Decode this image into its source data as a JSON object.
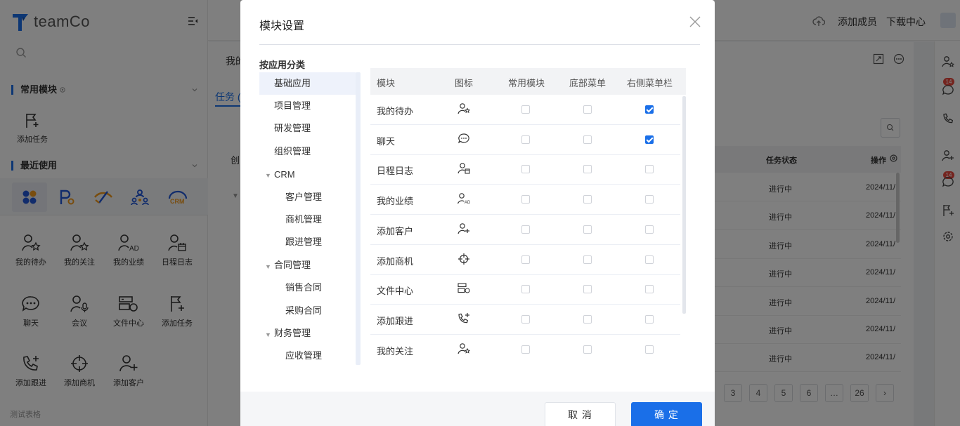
{
  "app": {
    "logo_text": "teamCo"
  },
  "sidebar": {
    "common_title": "常用模块",
    "common_tiles": [
      {
        "label": "添加任务",
        "icon": "flag-plus-icon"
      }
    ],
    "recent_title": "最近使用",
    "recent_icons": [
      "apps-icon",
      "project-p-icon",
      "dev-icon",
      "org-icon",
      "crm-icon"
    ],
    "recent_icon_crm_text": "CRM",
    "module_tiles": [
      {
        "label": "我的待办",
        "icon": "user-star-icon"
      },
      {
        "label": "我的关注",
        "icon": "user-star-outline-icon"
      },
      {
        "label": "我的业绩",
        "icon": "user-ad-icon"
      },
      {
        "label": "日程日志",
        "icon": "user-calendar-icon"
      },
      {
        "label": "聊天",
        "icon": "chat-icon"
      },
      {
        "label": "会议",
        "icon": "user-mic-icon"
      },
      {
        "label": "文件中心",
        "icon": "file-center-icon"
      },
      {
        "label": "添加任务",
        "icon": "flag-plus-icon"
      },
      {
        "label": "添加跟进",
        "icon": "phone-plus-icon"
      },
      {
        "label": "添加商机",
        "icon": "crosshair-icon"
      },
      {
        "label": "添加客户",
        "icon": "user-plus-icon"
      }
    ],
    "footer": "测试表格"
  },
  "topbar": {
    "add_member": "添加成员",
    "download_center": "下载中心"
  },
  "background": {
    "title": "我的",
    "tab": "任务 (",
    "create": "创",
    "table_headers": {
      "status": "任务状态",
      "action": "操作"
    },
    "rows": [
      {
        "status": "进行中",
        "date": "2024/11/"
      },
      {
        "status": "进行中",
        "date": "2024/11/"
      },
      {
        "status": "进行中",
        "date": "2024/11/"
      },
      {
        "status": "进行中",
        "date": "2024/11/"
      },
      {
        "status": "进行中",
        "date": "2024/11/"
      },
      {
        "status": "进行中",
        "date": "2024/11/"
      },
      {
        "status": "进行中",
        "date": "2024/11/"
      }
    ],
    "pagination": [
      "3",
      "4",
      "5",
      "6",
      "…",
      "26",
      "›"
    ],
    "badges": [
      "14",
      "14"
    ]
  },
  "modal": {
    "title": "模块设置",
    "category_label": "按应用分类",
    "tree": [
      {
        "label": "基础应用",
        "level": 0,
        "active": true
      },
      {
        "label": "项目管理",
        "level": 0
      },
      {
        "label": "研发管理",
        "level": 0
      },
      {
        "label": "组织管理",
        "level": 0
      },
      {
        "label": "CRM",
        "level": 0,
        "caret": true
      },
      {
        "label": "客户管理",
        "level": 1
      },
      {
        "label": "商机管理",
        "level": 1
      },
      {
        "label": "跟进管理",
        "level": 1
      },
      {
        "label": "合同管理",
        "level": 0,
        "caret": true
      },
      {
        "label": "销售合同",
        "level": 1
      },
      {
        "label": "采购合同",
        "level": 1
      },
      {
        "label": "财务管理",
        "level": 0,
        "caret": true
      },
      {
        "label": "应收管理",
        "level": 1
      }
    ],
    "columns": [
      "模块",
      "图标",
      "常用模块",
      "底部菜单",
      "右侧菜单栏"
    ],
    "rows": [
      {
        "name": "我的待办",
        "icon": "user-star-icon",
        "common": false,
        "bottom": false,
        "right": true
      },
      {
        "name": "聊天",
        "icon": "chat-icon",
        "common": false,
        "bottom": false,
        "right": true
      },
      {
        "name": "日程日志",
        "icon": "user-calendar-icon",
        "common": false,
        "bottom": false,
        "right": false
      },
      {
        "name": "我的业绩",
        "icon": "user-ad-icon",
        "common": false,
        "bottom": false,
        "right": false
      },
      {
        "name": "添加客户",
        "icon": "user-plus-icon",
        "common": false,
        "bottom": false,
        "right": false
      },
      {
        "name": "添加商机",
        "icon": "crosshair-icon",
        "common": false,
        "bottom": false,
        "right": false
      },
      {
        "name": "文件中心",
        "icon": "file-center-icon",
        "common": false,
        "bottom": false,
        "right": false
      },
      {
        "name": "添加跟进",
        "icon": "phone-plus-icon",
        "common": false,
        "bottom": false,
        "right": false
      },
      {
        "name": "我的关注",
        "icon": "user-star-outline-icon",
        "common": false,
        "bottom": false,
        "right": false
      }
    ],
    "cancel_label": "取 消",
    "ok_label": "确 定"
  },
  "colors": {
    "accent": "#1a6fe8",
    "badge": "#e8493f",
    "overlay": "rgba(0,0,0,0.5)"
  }
}
